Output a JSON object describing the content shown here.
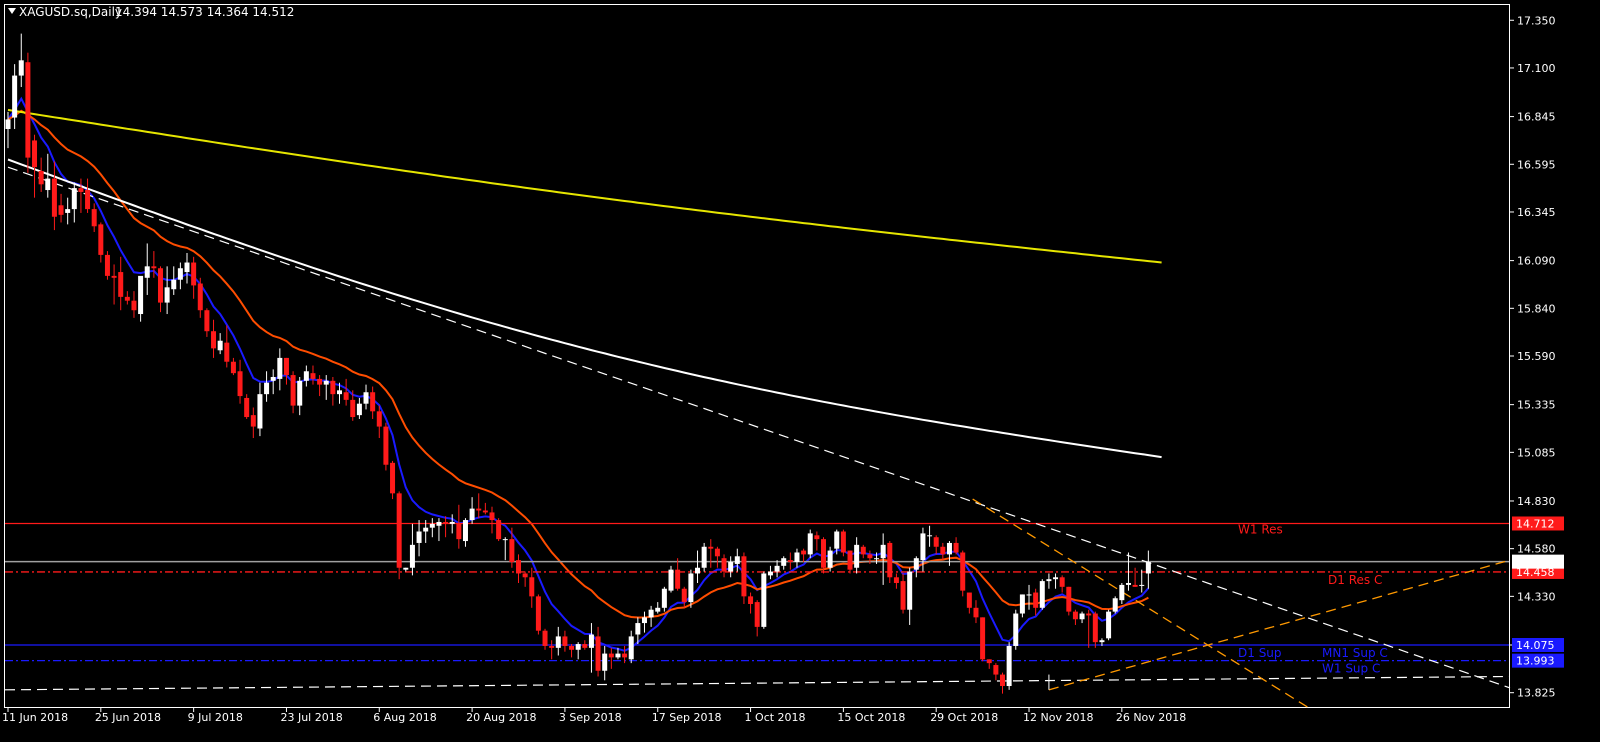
{
  "header": {
    "symbol": "XAGUSD.sq,Daily",
    "ohlc": "14.394 14.573 14.364 14.512"
  },
  "colors": {
    "background": "#000000",
    "bull": "#ffffff",
    "bear": "#ff1a1a",
    "ma_blue": "#1a1aff",
    "ma_orange": "#ff4d00",
    "ma_white": "#ffffff",
    "ma_yellow": "#e6e600",
    "res": "#ff1a1a",
    "sup": "#1a1aff",
    "trend": "#ff9900"
  },
  "chart_data": {
    "type": "candlestick",
    "ylim": [
      13.75,
      17.43
    ],
    "y_ticks": [
      "17.350",
      "17.100",
      "16.845",
      "16.595",
      "16.345",
      "16.090",
      "15.840",
      "15.590",
      "15.335",
      "15.085",
      "14.830",
      "14.580",
      "14.330",
      "14.075",
      "13.825"
    ],
    "x_labels": [
      "11 Jun 2018",
      "25 Jun 2018",
      "9 Jul 2018",
      "23 Jul 2018",
      "6 Aug 2018",
      "20 Aug 2018",
      "3 Sep 2018",
      "17 Sep 2018",
      "1 Oct 2018",
      "15 Oct 2018",
      "29 Oct 2018",
      "12 Nov 2018",
      "26 Nov 2018"
    ],
    "x_label_bars": [
      0,
      14,
      28,
      42,
      56,
      70,
      84,
      98,
      112,
      126,
      140,
      154,
      168
    ],
    "bar_count": 175,
    "bar_step": 6.63,
    "last_price": "14.512",
    "last_price_value": 14.512,
    "levels": [
      {
        "label": "W1 Res",
        "value": 14.712,
        "tag": "14.712",
        "kind": "res",
        "style": "solid"
      },
      {
        "label": "D1 Res C",
        "value": 14.458,
        "tag": "14.458",
        "kind": "res",
        "style": "dashdot"
      },
      {
        "label": "D1 Sup",
        "value": 14.075,
        "tag": "14.075",
        "kind": "sup",
        "style": "solid"
      },
      {
        "label": "MN1 Sup C",
        "value": 14.075,
        "tag": "",
        "kind": "sup",
        "style": "solid"
      },
      {
        "label": "W1 Sup C",
        "value": 13.993,
        "tag": "13.993",
        "kind": "sup",
        "style": "dashdot"
      }
    ],
    "candles_key": "OHLC arrays, bar index from 11 Jun 2018",
    "open": [
      16.78,
      16.84,
      17.06,
      17.13,
      16.72,
      16.56,
      16.46,
      16.52,
      16.38,
      16.34,
      16.36,
      16.47,
      16.46,
      16.36,
      16.28,
      16.12,
      16.01,
      16.03,
      15.9,
      15.88,
      15.81,
      16.0,
      16.06,
      16.05,
      15.87,
      15.94,
      15.99,
      16.03,
      16.08,
      15.97,
      15.83,
      15.72,
      15.62,
      15.66,
      15.56,
      15.51,
      15.37,
      15.28,
      15.21,
      15.39,
      15.46,
      15.47,
      15.58,
      15.49,
      15.33,
      15.46,
      15.5,
      15.47,
      15.44,
      15.46,
      15.39,
      15.4,
      15.36,
      15.28,
      15.34,
      15.4,
      15.3,
      15.22,
      15.03,
      14.87,
      14.47,
      14.48,
      14.61,
      14.67,
      14.69,
      14.7,
      14.72,
      14.71,
      14.71,
      14.62,
      14.73,
      14.79,
      14.78,
      14.77,
      14.73,
      14.63,
      14.63,
      14.52,
      14.45,
      14.43,
      14.33,
      14.15,
      14.07,
      14.06,
      14.12,
      14.07,
      14.05,
      14.08,
      14.06,
      14.12,
      13.94,
      14.03,
      14.01,
      14.03,
      14.0,
      14.13,
      14.19,
      14.22,
      14.25,
      14.27,
      14.36,
      14.47,
      14.37,
      14.3,
      14.45,
      14.48,
      14.59,
      14.58,
      14.53,
      14.46,
      14.5,
      14.54,
      14.33,
      14.3,
      14.17,
      14.44,
      14.46,
      14.49,
      14.52,
      14.51,
      14.57,
      14.55,
      14.65,
      14.63,
      14.48,
      14.58,
      14.67,
      14.57,
      14.48,
      14.59,
      14.55,
      14.53,
      14.53,
      14.61,
      14.43,
      14.41,
      14.26,
      14.47,
      14.52,
      14.65,
      14.64,
      14.59,
      14.55,
      14.61,
      14.56,
      14.35,
      14.27,
      14.22,
      14.0,
      13.97,
      13.92,
      13.86,
      14.07,
      14.24,
      14.34,
      14.35,
      14.27,
      14.41,
      14.42,
      14.43,
      14.38,
      14.25,
      14.21,
      14.24,
      14.24,
      14.09,
      14.11,
      14.25,
      14.31,
      14.39,
      14.39,
      14.39,
      14.45
    ],
    "high": [
      16.87,
      17.12,
      17.28,
      17.18,
      16.75,
      16.63,
      16.65,
      16.61,
      16.44,
      16.42,
      16.5,
      16.52,
      16.52,
      16.39,
      16.29,
      16.14,
      16.07,
      16.11,
      15.93,
      15.93,
      16.0,
      16.18,
      16.14,
      16.06,
      16.06,
      16.06,
      16.08,
      16.13,
      16.11,
      16.0,
      15.84,
      15.78,
      15.71,
      15.75,
      15.58,
      15.57,
      15.39,
      15.32,
      15.45,
      15.51,
      15.52,
      15.63,
      15.58,
      15.51,
      15.48,
      15.54,
      15.54,
      15.49,
      15.49,
      15.48,
      15.45,
      15.47,
      15.41,
      15.37,
      15.44,
      15.43,
      15.33,
      15.24,
      15.04,
      14.88,
      14.48,
      14.71,
      14.73,
      14.73,
      14.74,
      14.74,
      14.75,
      14.76,
      14.81,
      14.74,
      14.85,
      14.87,
      14.82,
      14.8,
      14.74,
      14.64,
      14.69,
      14.55,
      14.46,
      14.48,
      14.34,
      14.16,
      14.1,
      14.17,
      14.15,
      14.08,
      14.09,
      14.1,
      14.19,
      14.17,
      14.07,
      14.06,
      14.06,
      14.07,
      14.15,
      14.22,
      14.25,
      14.28,
      14.3,
      14.38,
      14.49,
      14.53,
      14.38,
      14.47,
      14.57,
      14.61,
      14.63,
      14.59,
      14.55,
      14.54,
      14.58,
      14.56,
      14.35,
      14.31,
      14.46,
      14.49,
      14.52,
      14.54,
      14.56,
      14.58,
      14.58,
      14.68,
      14.67,
      14.64,
      14.59,
      14.68,
      14.68,
      14.57,
      14.64,
      14.6,
      14.57,
      14.56,
      14.66,
      14.62,
      14.45,
      14.45,
      14.48,
      14.54,
      14.69,
      14.7,
      14.65,
      14.61,
      14.62,
      14.64,
      14.57,
      14.35,
      14.31,
      14.22,
      14.0,
      13.98,
      13.93,
      14.09,
      14.26,
      14.34,
      14.39,
      14.37,
      14.42,
      14.45,
      14.45,
      14.44,
      14.38,
      14.26,
      14.25,
      14.26,
      14.25,
      14.11,
      14.26,
      14.33,
      14.4,
      14.56,
      14.48,
      14.47,
      14.57
    ],
    "low": [
      16.68,
      16.78,
      17.0,
      16.55,
      16.42,
      16.45,
      16.42,
      16.25,
      16.29,
      16.28,
      16.29,
      16.34,
      16.34,
      16.24,
      16.08,
      15.99,
      15.86,
      15.83,
      15.86,
      15.79,
      15.77,
      15.91,
      16.0,
      15.82,
      15.81,
      15.91,
      15.94,
      15.97,
      15.89,
      15.79,
      15.69,
      15.58,
      15.6,
      15.53,
      15.49,
      15.34,
      15.26,
      15.16,
      15.17,
      15.35,
      15.39,
      15.41,
      15.44,
      15.29,
      15.28,
      15.43,
      15.44,
      15.38,
      15.36,
      15.33,
      15.34,
      15.33,
      15.25,
      15.26,
      15.31,
      15.26,
      15.16,
      14.99,
      14.84,
      14.42,
      14.46,
      14.44,
      14.54,
      14.61,
      14.64,
      14.62,
      14.64,
      14.66,
      14.58,
      14.59,
      14.71,
      14.74,
      14.76,
      14.66,
      14.62,
      14.52,
      14.48,
      14.4,
      14.38,
      14.27,
      14.13,
      14.05,
      14.0,
      14.02,
      14.04,
      14.01,
      14.0,
      14.05,
      13.93,
      13.91,
      13.89,
      13.95,
      14.0,
      13.98,
      13.98,
      14.08,
      14.14,
      14.17,
      14.24,
      14.25,
      14.35,
      14.36,
      14.27,
      14.27,
      14.4,
      14.46,
      14.48,
      14.48,
      14.43,
      14.43,
      14.46,
      14.29,
      14.24,
      14.12,
      14.16,
      14.42,
      14.43,
      14.47,
      14.47,
      14.48,
      14.51,
      14.53,
      14.57,
      14.45,
      14.46,
      14.55,
      14.54,
      14.45,
      14.45,
      14.53,
      14.5,
      14.5,
      14.39,
      14.4,
      14.37,
      14.24,
      14.18,
      14.43,
      14.46,
      14.59,
      14.55,
      14.52,
      14.49,
      14.55,
      14.33,
      14.24,
      14.19,
      13.99,
      13.95,
      13.89,
      13.82,
      13.84,
      14.05,
      14.22,
      14.26,
      14.23,
      14.26,
      14.37,
      14.37,
      14.35,
      14.23,
      14.18,
      14.19,
      14.06,
      14.06,
      14.07,
      14.1,
      14.24,
      14.29,
      14.36,
      14.38,
      14.35,
      14.37
    ],
    "close": [
      16.83,
      17.06,
      17.14,
      16.63,
      16.58,
      16.49,
      16.52,
      16.32,
      16.33,
      16.36,
      16.47,
      16.45,
      16.36,
      16.27,
      16.12,
      16.01,
      16.0,
      15.9,
      15.88,
      15.83,
      16.01,
      16.06,
      16.05,
      15.87,
      15.95,
      15.99,
      16.05,
      16.08,
      15.96,
      15.83,
      15.72,
      15.63,
      15.67,
      15.56,
      15.5,
      15.38,
      15.27,
      15.22,
      15.39,
      15.45,
      15.48,
      15.58,
      15.49,
      15.33,
      15.46,
      15.51,
      15.47,
      15.44,
      15.46,
      15.39,
      15.41,
      15.36,
      15.27,
      15.34,
      15.4,
      15.3,
      15.22,
      15.02,
      14.87,
      14.48,
      14.48,
      14.6,
      14.67,
      14.69,
      14.71,
      14.72,
      14.71,
      14.72,
      14.63,
      14.73,
      14.79,
      14.78,
      14.77,
      14.73,
      14.63,
      14.63,
      14.51,
      14.45,
      14.43,
      14.33,
      14.15,
      14.07,
      14.06,
      14.12,
      14.07,
      14.05,
      14.08,
      14.06,
      14.13,
      13.94,
      14.03,
      14.01,
      14.03,
      14.01,
      14.12,
      14.19,
      14.22,
      14.26,
      14.27,
      14.37,
      14.47,
      14.37,
      14.3,
      14.45,
      14.48,
      14.59,
      14.58,
      14.54,
      14.46,
      14.51,
      14.54,
      14.33,
      14.29,
      14.17,
      14.45,
      14.46,
      14.49,
      14.53,
      14.51,
      14.56,
      14.55,
      14.66,
      14.63,
      14.48,
      14.57,
      14.67,
      14.56,
      14.47,
      14.6,
      14.55,
      14.53,
      14.53,
      14.6,
      14.43,
      14.4,
      14.26,
      14.46,
      14.53,
      14.66,
      14.65,
      14.59,
      14.55,
      14.61,
      14.56,
      14.36,
      14.27,
      14.22,
      14.0,
      13.98,
      13.92,
      13.86,
      14.07,
      14.24,
      14.34,
      14.34,
      14.27,
      14.41,
      14.42,
      14.43,
      14.38,
      14.25,
      14.21,
      14.24,
      14.23,
      14.09,
      14.1,
      14.25,
      14.32,
      14.39,
      14.4,
      14.38,
      14.39,
      14.51
    ]
  }
}
